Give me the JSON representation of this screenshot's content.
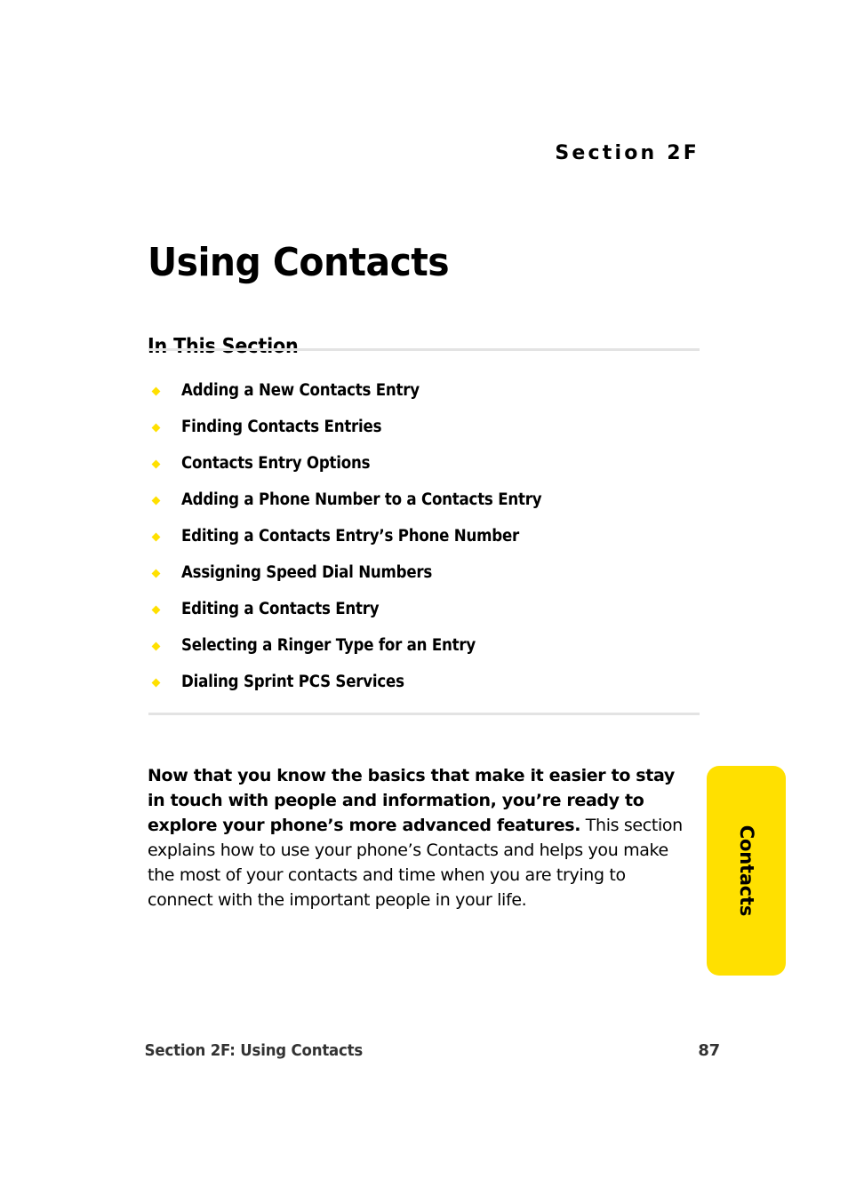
{
  "page": {
    "section_eyebrow": "Section 2F",
    "title": "Using Contacts",
    "subhead": "In This Section",
    "page_number": "87",
    "footer_text": "Section 2F: Using Contacts",
    "accent_color": "#FFE000",
    "rule_color": "#E3E3E3",
    "text_color": "#000000",
    "footer_color": "#333333"
  },
  "toc": {
    "items": [
      {
        "label": "Adding a New Contacts Entry"
      },
      {
        "label": "Finding Contacts Entries"
      },
      {
        "label": "Contacts Entry Options"
      },
      {
        "label": "Adding a Phone Number to a Contacts Entry"
      },
      {
        "label": "Editing a Contacts Entry’s Phone Number"
      },
      {
        "label": "Assigning Speed Dial Numbers"
      },
      {
        "label": "Editing a Contacts Entry"
      },
      {
        "label": "Selecting a Ringer Type for an Entry"
      },
      {
        "label": "Dialing Sprint PCS Services"
      }
    ]
  },
  "intro": {
    "lead": "Now that you know the basics that make it easier to stay in touch with people and information, you’re ready to explore your phone’s more advanced features.",
    "rest": " This section explains how to use your phone’s Contacts and helps you make the most of your contacts and time when you are trying to connect with the important people in your life."
  },
  "side_tab": {
    "label": "Contacts"
  }
}
